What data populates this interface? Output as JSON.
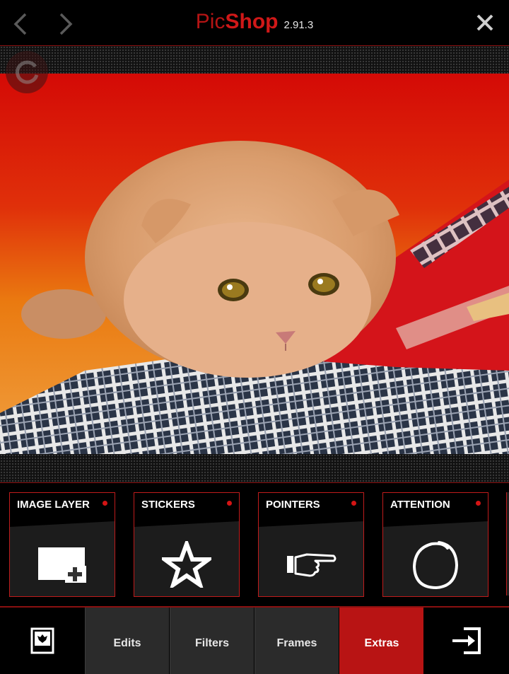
{
  "header": {
    "logo_pic": "Pic",
    "logo_shop": "Shop",
    "version": "2.91.3",
    "back_icon": "chevron-left-icon",
    "forward_icon": "chevron-right-icon",
    "close_icon": "close-icon"
  },
  "canvas": {
    "reset_icon": "rotate-icon"
  },
  "tools": [
    {
      "label": "IMAGE LAYER",
      "icon": "image-layer-add-icon"
    },
    {
      "label": "STICKERS",
      "icon": "star-icon"
    },
    {
      "label": "POINTERS",
      "icon": "pointing-hand-icon"
    },
    {
      "label": "ATTENTION",
      "icon": "circle-scribble-icon"
    }
  ],
  "bottom": {
    "left_icon": "picture-frame-icon",
    "tabs": [
      "Edits",
      "Filters",
      "Frames",
      "Extras"
    ],
    "active_tab": "Extras",
    "right_icon": "export-icon"
  },
  "colors": {
    "accent": "#b81414",
    "logo": "#d01818",
    "tab_bg": "#2b2b2b"
  }
}
